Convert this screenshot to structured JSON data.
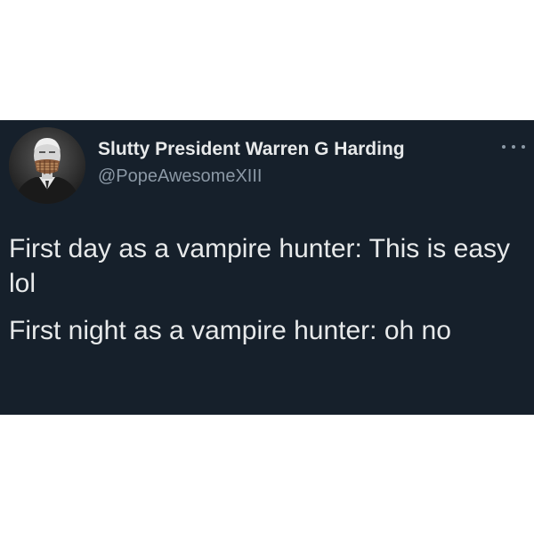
{
  "tweet": {
    "author": {
      "display_name": "Slutty President Warren G Harding",
      "handle": "@PopeAwesomeXIII"
    },
    "more_icon": "more-options-icon",
    "paragraphs": [
      "First day as a vampire hunter: This is easy lol",
      "First night as a vampire hunter: oh no"
    ]
  },
  "colors": {
    "card_background": "#16202b",
    "text_primary": "#e7e9ea",
    "text_secondary": "#8b98a5",
    "page_background": "#ffffff"
  }
}
